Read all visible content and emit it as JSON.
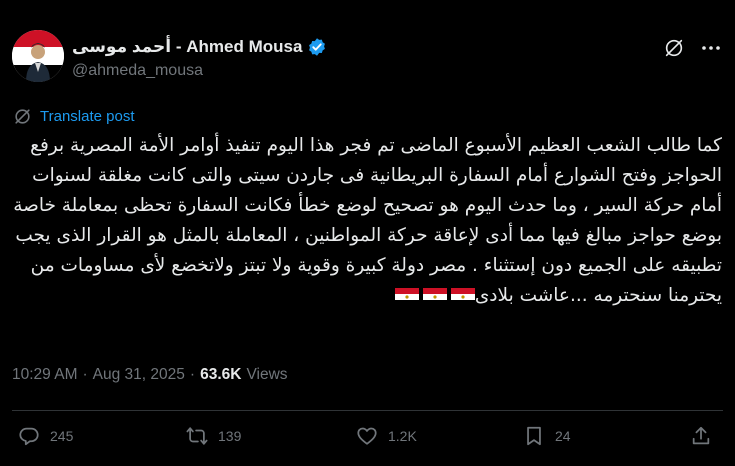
{
  "author": {
    "display_name": "أحمد موسى - Ahmed Mousa",
    "handle": "@ahmeda_mousa",
    "avatar_icon": "avatar-egypt-flag"
  },
  "translate_label": "Translate post",
  "post": {
    "text": "كما طالب الشعب العظيم الأسبوع الماضى تم فجر هذا اليوم تنفيذ أوامر الأمة المصرية برفع الحواجز وفتح الشوارع أمام السفارة البريطانية فى جاردن سيتى والتى كانت مغلقة لسنوات أمام حركة السير ، وما حدث اليوم هو تصحيح لوضع خطأ فكانت السفارة تحظى بمعاملة خاصة بوضع حواجز مبالغ فيها مما أدى لإعاقة حركة المواطنين ، المعاملة بالمثل هو القرار الذى يجب تطبيقه على الجميع دون إستثناء . مصر دولة كبيرة وقوية ولا تبتز ولاتخضع لأى مساومات من يحترمنا سنحترمه ...عاشت بلادى",
    "flag_emoji_count": 3
  },
  "meta": {
    "time": "10:29 AM",
    "separator": "·",
    "date": "Aug 31, 2025",
    "separator2": "·",
    "views_count": "63.6K",
    "views_label": "Views"
  },
  "actions": {
    "replies": "245",
    "reposts": "139",
    "likes": "1.2K",
    "bookmarks": "24"
  },
  "colors": {
    "background": "#000000",
    "text": "#e7e9ea",
    "muted": "#71767b",
    "accent": "#1d9bf0",
    "divider": "#2f3336"
  }
}
